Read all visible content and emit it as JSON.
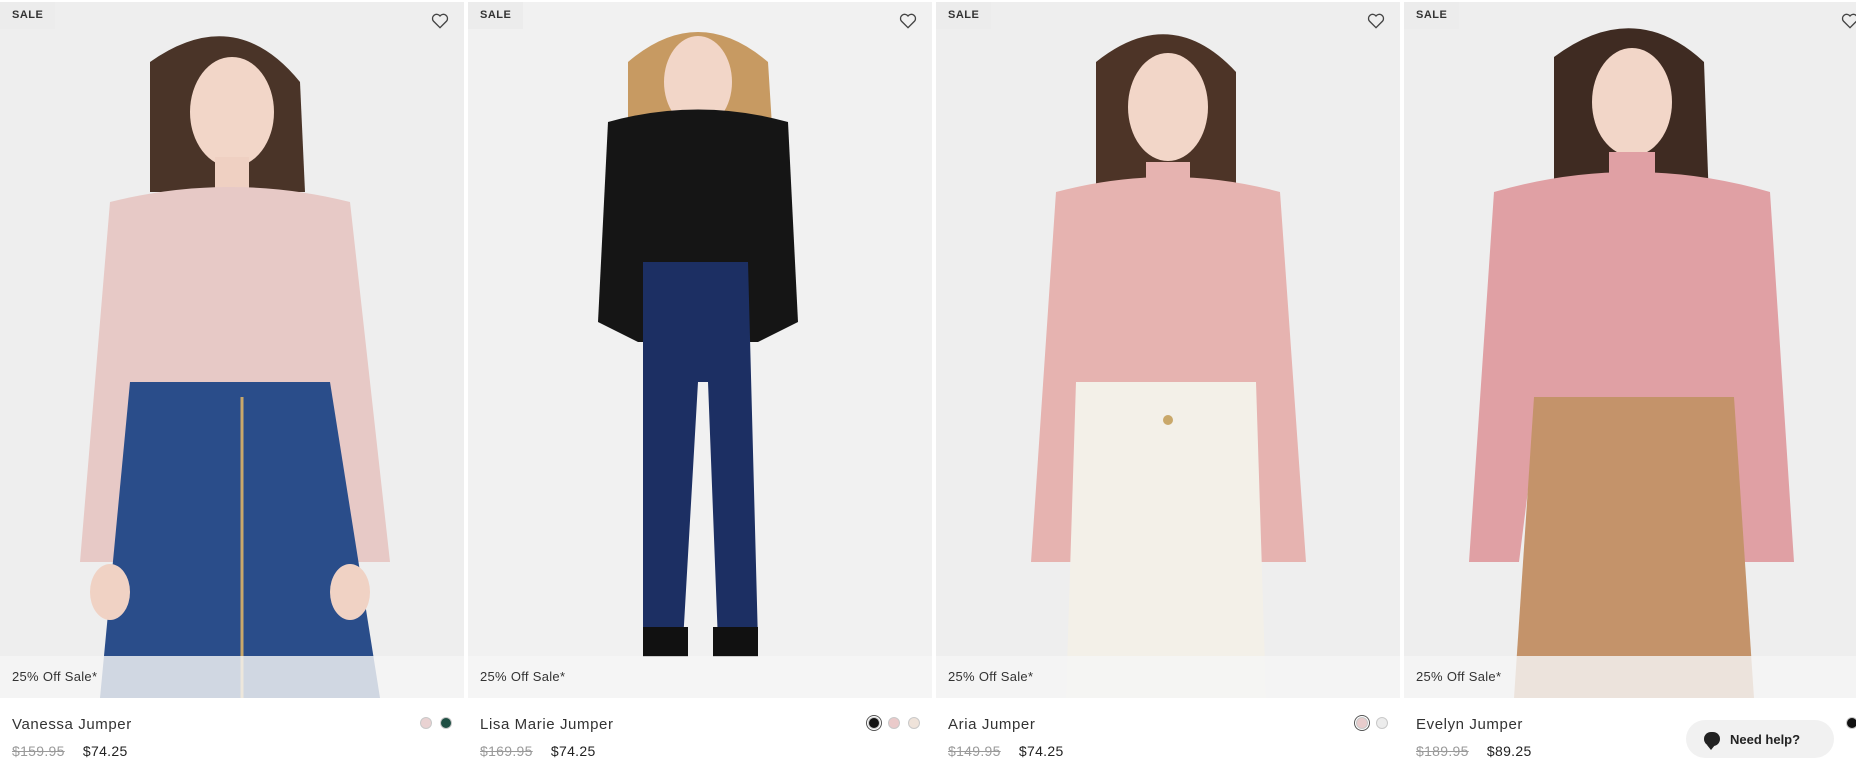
{
  "badges": {
    "sale": "SALE"
  },
  "products": [
    {
      "name": "Vanessa Jumper",
      "promo": "25% Off Sale*",
      "was": "$159.95",
      "now": "$74.25",
      "swatches": [
        "#e9d2d2",
        "#1f4f43"
      ],
      "top_color": "#e7c9c6",
      "bottom_color": "#2a4d8a"
    },
    {
      "name": "Lisa Marie Jumper",
      "promo": "25% Off Sale*",
      "was": "$169.95",
      "now": "$74.25",
      "swatches": [
        "#111111",
        "#eacaca",
        "#efe3da"
      ],
      "top_color": "#151515",
      "bottom_color": "#1c2f63"
    },
    {
      "name": "Aria Jumper",
      "promo": "25% Off Sale*",
      "was": "$149.95",
      "now": "$74.25",
      "swatches": [
        "#e8cccc",
        "#ececec"
      ],
      "top_color": "#e6b3b0",
      "bottom_color": "#f3f0e8"
    },
    {
      "name": "Evelyn Jumper",
      "promo": "25% Off Sale*",
      "was": "$189.95",
      "now": "$89.25",
      "swatches": [
        "#111111"
      ],
      "top_color": "#e0a0a4",
      "bottom_color": "#c4936a"
    }
  ],
  "help": {
    "label": "Need help?"
  }
}
